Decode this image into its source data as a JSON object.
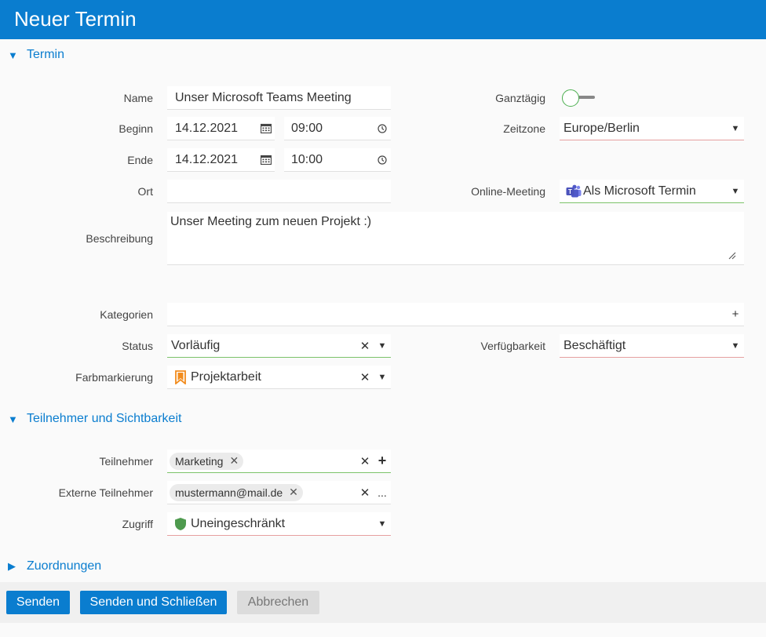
{
  "header": {
    "title": "Neuer Termin"
  },
  "sections": {
    "termin": "Termin",
    "teilnehmer": "Teilnehmer und Sichtbarkeit",
    "zuordnungen": "Zuordnungen"
  },
  "labels": {
    "name": "Name",
    "beginn": "Beginn",
    "ende": "Ende",
    "ort": "Ort",
    "beschreibung": "Beschreibung",
    "kategorien": "Kategorien",
    "status": "Status",
    "farbmarkierung": "Farbmarkierung",
    "ganztaegig": "Ganztägig",
    "zeitzone": "Zeitzone",
    "online_meeting": "Online-Meeting",
    "verfuegbarkeit": "Verfügbarkeit",
    "teilnehmer": "Teilnehmer",
    "externe_teilnehmer": "Externe Teilnehmer",
    "zugriff": "Zugriff"
  },
  "fields": {
    "name": "Unser Microsoft Teams Meeting",
    "beginn_date": "14.12.2021",
    "beginn_time": "09:00",
    "ende_date": "14.12.2021",
    "ende_time": "10:00",
    "ort": "",
    "beschreibung": "Unser Meeting zum neuen Projekt :)",
    "kategorien": "",
    "status": "Vorläufig",
    "farbmarkierung": "Projektarbeit",
    "zeitzone": "Europe/Berlin",
    "online_meeting": "Als Microsoft Termin",
    "verfuegbarkeit": "Beschäftigt",
    "ganztaegig_on": false,
    "teilnehmer_chip": "Marketing",
    "externe_chip": "mustermann@mail.de",
    "zugriff": "Uneingeschränkt",
    "more_dots": "..."
  },
  "buttons": {
    "senden": "Senden",
    "senden_schliessen": "Senden und Schließen",
    "abbrechen": "Abbrechen"
  },
  "colors": {
    "accent": "#0a7dcf",
    "valid": "#7cc36a",
    "invalid": "#e6a0a0",
    "bookmark": "#f28c1e",
    "shield": "#4e9a4e"
  }
}
